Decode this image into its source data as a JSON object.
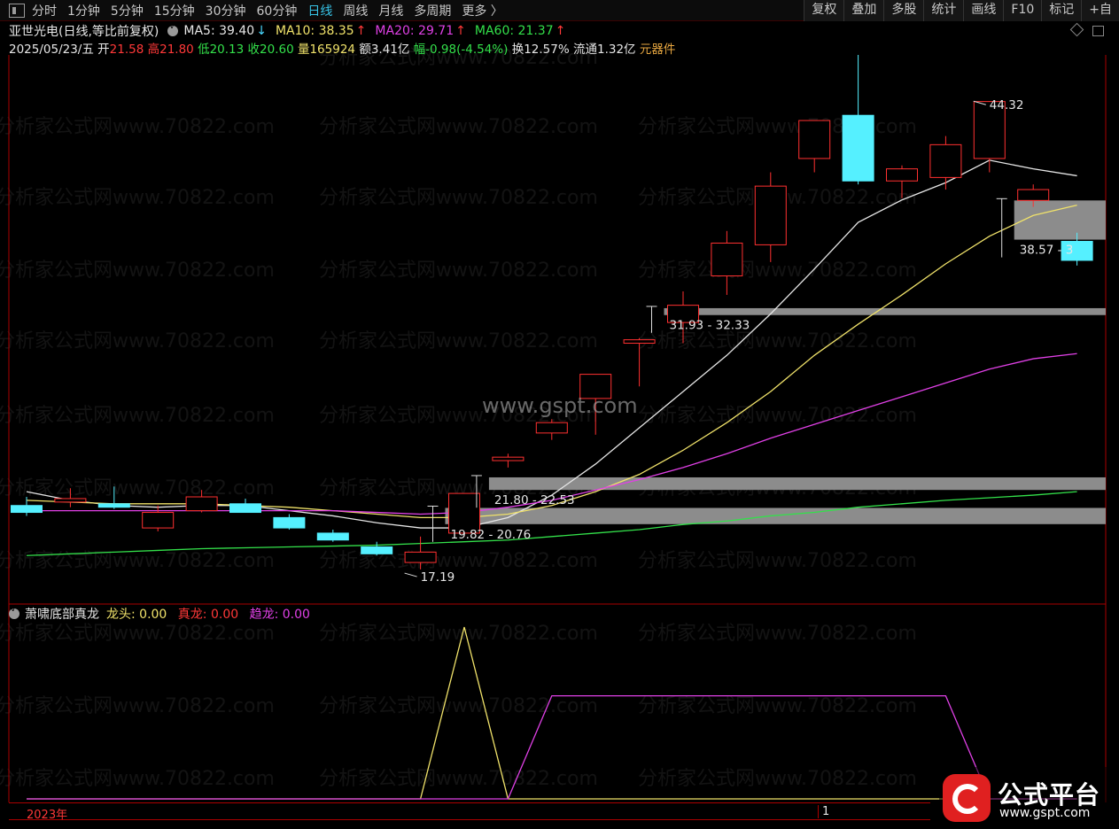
{
  "toolbar": {
    "tabs": [
      "分时",
      "1分钟",
      "5分钟",
      "15分钟",
      "30分钟",
      "60分钟",
      "日线",
      "周线",
      "月线",
      "多周期",
      "更多 〉"
    ],
    "active": "日线",
    "buttons": [
      "复权",
      "叠加",
      "多股",
      "统计",
      "画线",
      "F10",
      "标记",
      "+自"
    ]
  },
  "info": {
    "stock": "亚世光电",
    "mode": "(日线,等比前复权)",
    "ma": [
      {
        "label": "MA5:",
        "value": "39.40",
        "dir": "↓",
        "color": "#e6e6e6"
      },
      {
        "label": "MA10:",
        "value": "38.35",
        "dir": "↑",
        "color": "#f0e26a"
      },
      {
        "label": "MA20:",
        "value": "29.71",
        "dir": "↑",
        "color": "#e040e6"
      },
      {
        "label": "MA60:",
        "value": "21.37",
        "dir": "↑",
        "color": "#33e04a"
      }
    ],
    "date": "2025/05/23/五",
    "open_label": "开",
    "open": "21.58",
    "high_label": "高",
    "high": "21.80",
    "low_label": "低",
    "low": "20.13",
    "close_label": "收",
    "close": "20.60",
    "vol_label": "量",
    "vol": "165924",
    "amt_label": "额",
    "amt": "3.41亿",
    "chg_label": "幅",
    "chg": "-0.98(-4.54%)",
    "turn_label": "换",
    "turn": "12.57%",
    "float_label": "流通",
    "float": "1.32亿",
    "sector": "元器件"
  },
  "indicator": {
    "name": "萧啸底部真龙",
    "items": [
      {
        "label": "龙头:",
        "value": "0.00",
        "color": "#f0e26a"
      },
      {
        "label": "真龙:",
        "value": "0.00",
        "color": "#ff3838"
      },
      {
        "label": "趋龙:",
        "value": "0.00",
        "color": "#e040e6"
      }
    ]
  },
  "datebar": {
    "year": "2023年",
    "page": "1"
  },
  "logo": {
    "title": "公式平台",
    "url": "www.gspt.com"
  },
  "watermark": {
    "site": "分析家公式网www.70822.com",
    "center": "www.gspt.com"
  },
  "chart_data": {
    "type": "candlestick",
    "price_range": [
      15.5,
      47
    ],
    "candles": [
      {
        "open": 20.9,
        "high": 21.4,
        "low": 20.3,
        "close": 20.5
      },
      {
        "open": 21.1,
        "high": 21.9,
        "low": 20.8,
        "close": 21.3
      },
      {
        "open": 21.0,
        "high": 22.0,
        "low": 20.7,
        "close": 20.8
      },
      {
        "open": 19.6,
        "high": 20.9,
        "low": 19.4,
        "close": 20.5
      },
      {
        "open": 20.6,
        "high": 21.8,
        "low": 20.5,
        "close": 21.4
      },
      {
        "open": 21.0,
        "high": 21.3,
        "low": 20.5,
        "close": 20.5
      },
      {
        "open": 20.2,
        "high": 20.4,
        "low": 19.5,
        "close": 19.6
      },
      {
        "open": 19.3,
        "high": 19.5,
        "low": 18.8,
        "close": 18.9
      },
      {
        "open": 18.5,
        "high": 18.8,
        "low": 18.0,
        "close": 18.1
      },
      {
        "open": 17.6,
        "high": 19.1,
        "low": 17.2,
        "close": 18.2
      },
      {
        "open": 19.3,
        "high": 21.6,
        "low": 19.1,
        "close": 21.6
      },
      {
        "open": 23.5,
        "high": 23.9,
        "low": 23.1,
        "close": 23.7
      },
      {
        "open": 25.1,
        "high": 25.9,
        "low": 24.7,
        "close": 25.7
      },
      {
        "open": 27.1,
        "high": 28.5,
        "low": 25.0,
        "close": 28.5
      },
      {
        "open": 30.3,
        "high": 30.6,
        "low": 27.8,
        "close": 30.5
      },
      {
        "open": 31.5,
        "high": 33.3,
        "low": 30.3,
        "close": 32.5
      },
      {
        "open": 34.2,
        "high": 36.8,
        "low": 33.1,
        "close": 36.1
      },
      {
        "open": 36.0,
        "high": 40.2,
        "low": 35.0,
        "close": 39.4
      },
      {
        "open": 41.0,
        "high": 43.2,
        "low": 40.2,
        "close": 43.2
      },
      {
        "open": 43.5,
        "high": 47.0,
        "low": 39.5,
        "close": 39.7
      },
      {
        "open": 39.7,
        "high": 40.6,
        "low": 38.7,
        "close": 40.4
      },
      {
        "open": 39.9,
        "high": 42.3,
        "low": 39.2,
        "close": 41.8
      },
      {
        "open": 41.0,
        "high": 44.32,
        "low": 40.2,
        "close": 44.3
      },
      {
        "open": 38.57,
        "high": 39.5,
        "low": 38.2,
        "close": 39.2
      },
      {
        "open": 36.2,
        "high": 36.7,
        "low": 34.8,
        "close": 35.1
      }
    ],
    "ma": {
      "MA5": {
        "color": "#e6e6e6",
        "values": [
          21.7,
          21.2,
          20.9,
          20.8,
          20.9,
          20.9,
          20.6,
          20.3,
          19.9,
          19.6,
          19.6,
          20.2,
          21.5,
          23.3,
          25.4,
          27.5,
          29.6,
          32.0,
          34.6,
          37.3,
          38.6,
          39.6,
          40.9,
          40.4,
          40.0
        ]
      },
      "MA10": {
        "color": "#f0e26a",
        "values": [
          21.2,
          21.1,
          21.0,
          21.0,
          21.0,
          20.9,
          20.8,
          20.6,
          20.4,
          20.2,
          20.2,
          20.4,
          20.9,
          21.7,
          22.7,
          24.1,
          25.7,
          27.5,
          29.6,
          31.4,
          33.1,
          34.9,
          36.5,
          37.7,
          38.3
        ]
      },
      "MA20": {
        "color": "#e040e6",
        "values": [
          20.6,
          20.6,
          20.6,
          20.6,
          20.6,
          20.6,
          20.6,
          20.6,
          20.5,
          20.4,
          20.5,
          20.8,
          21.2,
          21.8,
          22.4,
          23.1,
          23.9,
          24.8,
          25.6,
          26.4,
          27.2,
          28.0,
          28.8,
          29.4,
          29.7
        ]
      },
      "MA60": {
        "color": "#33e04a",
        "values": [
          18.0,
          18.1,
          18.2,
          18.3,
          18.4,
          18.45,
          18.5,
          18.55,
          18.6,
          18.7,
          18.8,
          18.9,
          19.1,
          19.3,
          19.5,
          19.8,
          20.0,
          20.3,
          20.5,
          20.8,
          21.0,
          21.2,
          21.35,
          21.5,
          21.7
        ]
      }
    },
    "zones": [
      {
        "label": "19.82 - 20.76",
        "low": 19.82,
        "high": 20.76,
        "from": 10
      },
      {
        "label": "21.80 - 22.53",
        "low": 21.8,
        "high": 22.53,
        "from": 11
      },
      {
        "label": "31.93 - 32.33",
        "low": 31.93,
        "high": 32.33,
        "from": 15
      },
      {
        "label": "38.57 - 3",
        "low": 36.3,
        "high": 38.57,
        "from": 23
      }
    ],
    "extremes": [
      {
        "label": "44.32",
        "value": 44.32,
        "index": 22
      },
      {
        "label": "17.19",
        "value": 17.19,
        "index": 9
      }
    ],
    "indicator": {
      "range": [
        0,
        1
      ],
      "series": [
        {
          "name": "龙头",
          "color": "#f0e26a",
          "values": [
            0,
            0,
            0,
            0,
            0,
            0,
            0,
            0,
            0,
            0,
            1,
            0,
            0,
            0,
            0,
            0,
            0,
            0,
            0,
            0,
            0,
            0,
            0,
            0,
            0
          ]
        },
        {
          "name": "趋龙",
          "color": "#e040e6",
          "values": [
            0,
            0,
            0,
            0,
            0,
            0,
            0,
            0,
            0,
            0,
            0,
            0,
            0.6,
            0.6,
            0.6,
            0.6,
            0.6,
            0.6,
            0.6,
            0.6,
            0.6,
            0.6,
            0,
            0,
            0
          ]
        }
      ]
    }
  }
}
